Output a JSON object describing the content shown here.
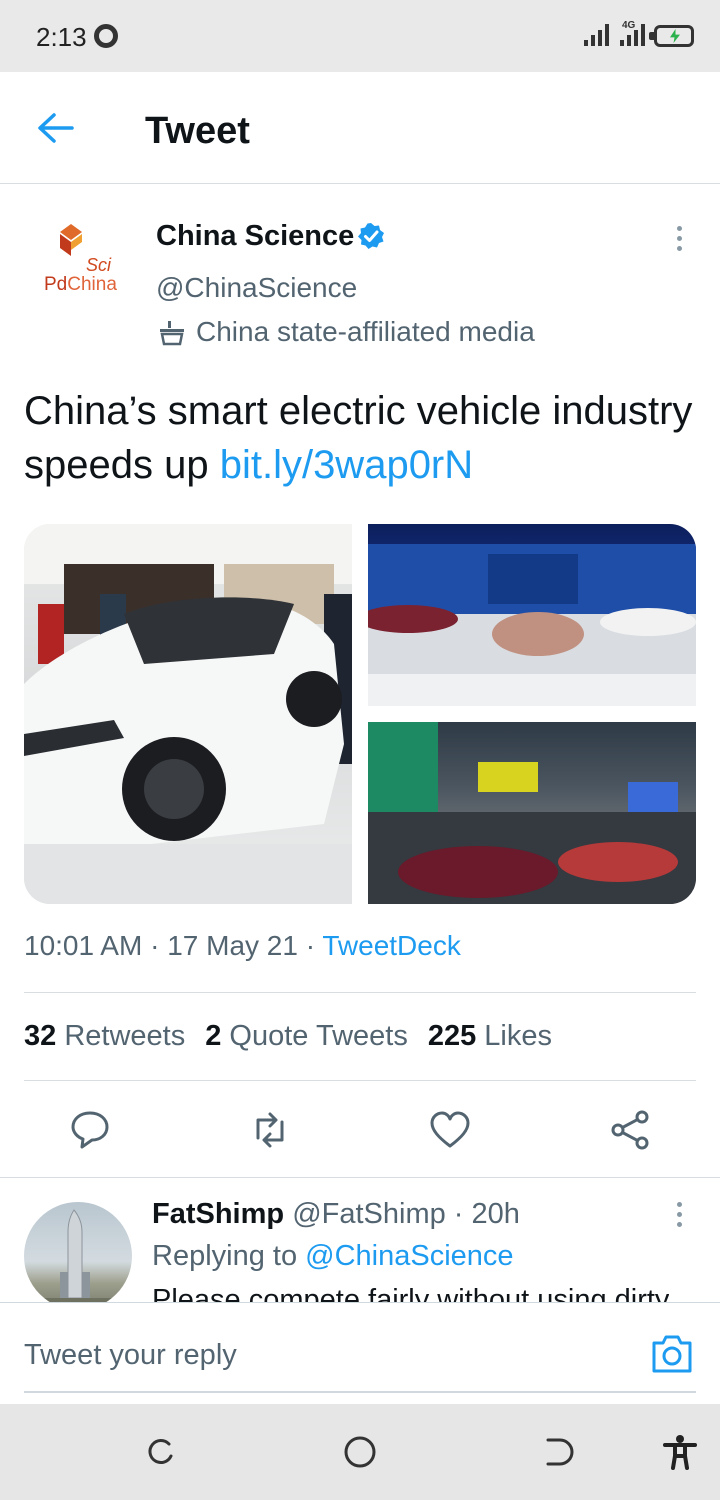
{
  "status_bar": {
    "time": "2:13",
    "network": "4G"
  },
  "header": {
    "title": "Tweet"
  },
  "author": {
    "logo_sci": "Sci",
    "logo_pd": "Pd",
    "logo_china": "China",
    "name": "China Science",
    "handle": "@ChinaScience",
    "affiliation": "China state-affiliated media"
  },
  "tweet": {
    "text": "China’s smart electric vehicle industry speeds up ",
    "link": "bit.ly/3wap0rN",
    "time": "10:01 AM",
    "date": "17 May 21",
    "source": "TweetDeck",
    "separator": " · "
  },
  "stats": {
    "retweets_count": "32",
    "retweets_label": "Retweets",
    "quotes_count": "2",
    "quotes_label": "Quote Tweets",
    "likes_count": "225",
    "likes_label": "Likes"
  },
  "reply": {
    "name": "FatShimp",
    "handle": "@FatShimp",
    "age": "20h",
    "replying_prefix": "Replying to ",
    "replying_to": "@ChinaScience",
    "text": "Please compete fairly without using dirty"
  },
  "compose": {
    "placeholder": "Tweet your reply"
  },
  "colors": {
    "accent": "#1d9bf0",
    "text": "#0f1419",
    "muted": "#536471"
  }
}
